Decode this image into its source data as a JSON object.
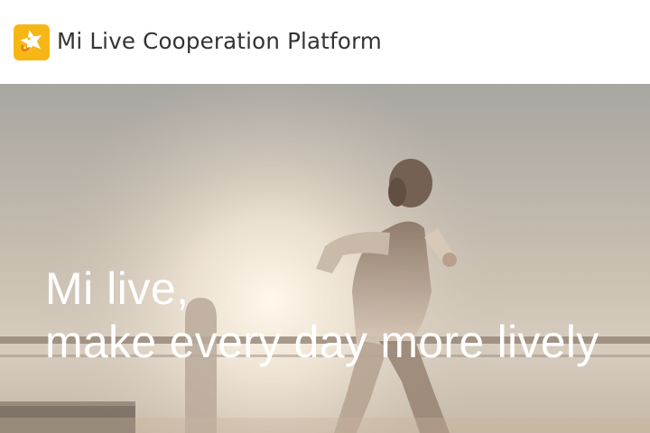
{
  "header": {
    "logo_icon": "mi-live-star-logo-icon",
    "title": "Mi Live Cooperation Platform",
    "logo_color": "#f6b716"
  },
  "hero": {
    "image": "runner-at-sunrise-photo",
    "slogan_line1": "Mi live,",
    "slogan_line2": "make every day more lively"
  }
}
